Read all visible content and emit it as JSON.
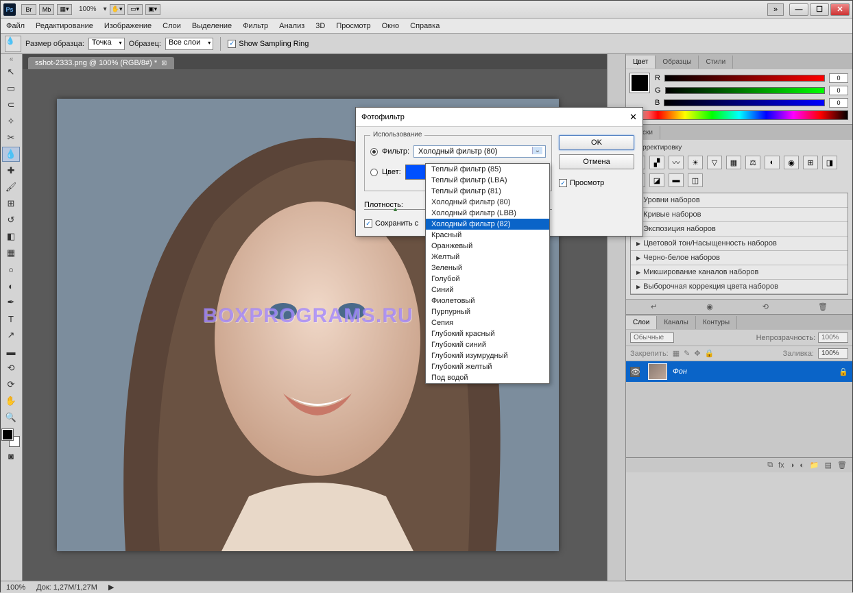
{
  "titlebar": {
    "zoom": "100%"
  },
  "window": {
    "min": "—",
    "max": "☐",
    "close": "✕"
  },
  "menu": [
    "Файл",
    "Редактирование",
    "Изображение",
    "Слои",
    "Выделение",
    "Фильтр",
    "Анализ",
    "3D",
    "Просмотр",
    "Окно",
    "Справка"
  ],
  "options": {
    "sample_label": "Размер образца:",
    "sample_value": "Точка",
    "sample2_label": "Образец:",
    "sample2_value": "Все слои",
    "ring_label": "Show Sampling Ring",
    "ring_checked": "✓"
  },
  "doc_tab": {
    "title": "sshot-2333.png @ 100% (RGB/8#) *",
    "close": "⊠"
  },
  "watermark": "BOXPROGRAMS.RU",
  "color_panel": {
    "tabs": [
      "Цвет",
      "Образцы",
      "Стили"
    ],
    "r": "R",
    "g": "G",
    "b": "B",
    "rv": "0",
    "gv": "0",
    "bv": "0"
  },
  "adj_panel": {
    "masks_tab": "Маски",
    "label": "ь корректировку",
    "presets": [
      "Уровни наборов",
      "Кривые наборов",
      "Экспозиция наборов",
      "Цветовой тон/Насыщенность наборов",
      "Черно-белое наборов",
      "Микширование каналов наборов",
      "Выборочная коррекция цвета наборов"
    ]
  },
  "layers_panel": {
    "tabs": [
      "Слои",
      "Каналы",
      "Контуры"
    ],
    "blend": "Обычные",
    "opacity_label": "Непрозрачность:",
    "opacity": "100%",
    "lock_label": "Закрепить:",
    "fill_label": "Заливка:",
    "fill": "100%",
    "layer_name": "Фон"
  },
  "statusbar": {
    "zoom": "100%",
    "doc": "Док: 1,27M/1,27M"
  },
  "dialog": {
    "title": "Фотофильтр",
    "usage": "Использование",
    "filter_label": "Фильтр:",
    "filter_value": "Холодный фильтр (80)",
    "color_label": "Цвет:",
    "density_label": "Плотность:",
    "preserve": "Сохранить с",
    "ok": "OK",
    "cancel": "Отмена",
    "preview": "Просмотр",
    "check": "✓"
  },
  "dropdown": {
    "items": [
      "Теплый фильтр (85)",
      "Теплый фильтр (LBA)",
      "Теплый фильтр (81)",
      "Холодный фильтр (80)",
      "Холодный фильтр (LBB)",
      "Холодный фильтр (82)",
      "Красный",
      "Оранжевый",
      "Желтый",
      "Зеленый",
      "Голубой",
      "Синий",
      "Фиолетовый",
      "Пурпурный",
      "Сепия",
      "Глубокий красный",
      "Глубокий синий",
      "Глубокий изумрудный",
      "Глубокий желтый",
      "Под водой"
    ],
    "highlight_index": 5
  }
}
